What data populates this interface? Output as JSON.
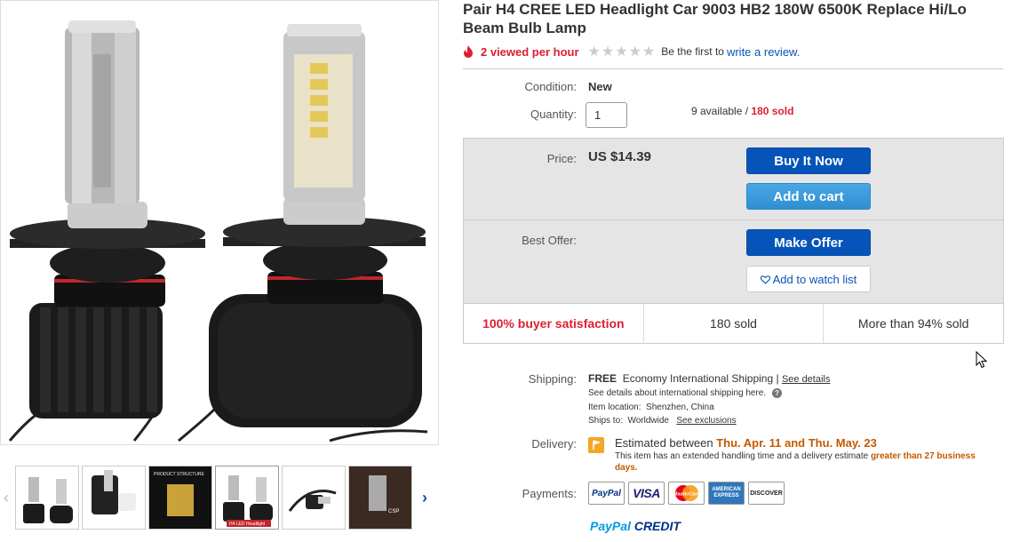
{
  "gallery": {
    "main_image_desc": "pair of LED headlight bulbs",
    "thumbnails": [
      {
        "name": "thumb-1",
        "label": ""
      },
      {
        "name": "thumb-2",
        "label": ""
      },
      {
        "name": "thumb-3",
        "label": "PRODUCT STRUCTURE"
      },
      {
        "name": "thumb-4",
        "label": "H4 LED Headlight"
      },
      {
        "name": "thumb-5",
        "label": ""
      },
      {
        "name": "thumb-6",
        "label": "CSP"
      }
    ],
    "active_index": 3
  },
  "product": {
    "title": "Pair H4 CREE LED Headlight Car 9003 HB2 180W 6500K Replace Hi/Lo Beam Bulb Lamp",
    "views": "2 viewed per hour",
    "stars": "★★★★★",
    "review_prefix": "Be the first to",
    "review_link": "write a review."
  },
  "condition": {
    "label": "Condition:",
    "value": "New"
  },
  "quantity": {
    "label": "Quantity:",
    "value": "1",
    "available": "9 available /",
    "sold": "180 sold"
  },
  "buy": {
    "price_label": "Price:",
    "price": "US $14.39",
    "buy_now": "Buy It Now",
    "add_to_cart": "Add to cart",
    "best_offer_label": "Best Offer:",
    "make_offer": "Make Offer",
    "watch": "Add to watch list",
    "stats": [
      "100% buyer satisfaction",
      "180 sold",
      "More than 94% sold"
    ]
  },
  "shipping": {
    "label": "Shipping:",
    "free": "FREE",
    "method": "Economy International Shipping |",
    "details_link": "See details",
    "intl_note": "See details about international shipping here.",
    "location_label": "Item location:",
    "location": "Shenzhen, China",
    "ships_to_label": "Ships to:",
    "ships_to": "Worldwide",
    "exclusions_link": "See exclusions"
  },
  "delivery": {
    "label": "Delivery:",
    "prefix": "Estimated between",
    "dates": "Thu. Apr. 11 and Thu. May. 23",
    "note": "This item has an extended handling time and a delivery estimate",
    "note_highlight": "greater than 27 business days."
  },
  "payments": {
    "label": "Payments:",
    "methods": [
      "PayPal",
      "VISA",
      "MasterCard",
      "AMERICAN EXPRESS",
      "DISCOVER"
    ],
    "credit": "PayPal",
    "credit_suffix": "CREDIT"
  },
  "colors": {
    "accent": "#0654ba",
    "red": "#dd1e31",
    "orange": "#c45800"
  }
}
